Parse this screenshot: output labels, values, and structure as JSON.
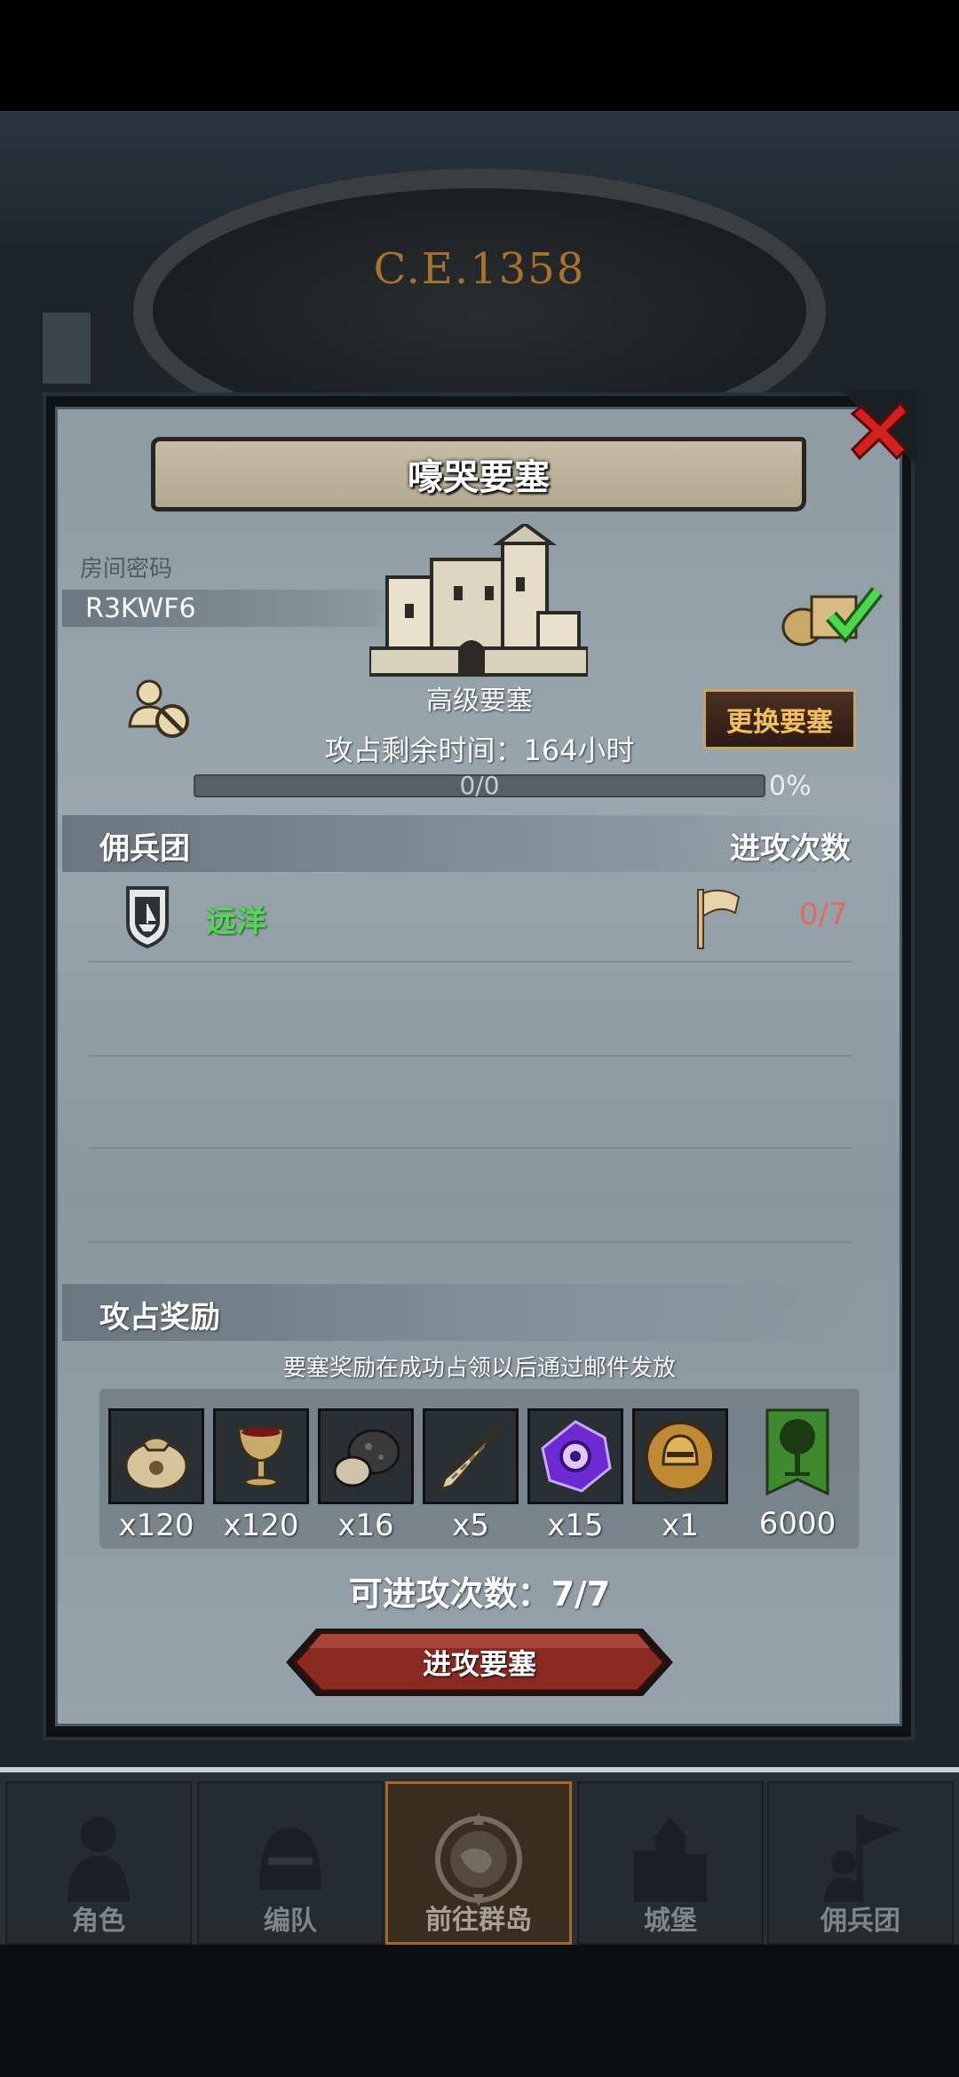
{
  "world": {
    "year_label": "C.E.1358"
  },
  "dialog": {
    "title": "嚎哭要塞",
    "room_password_label": "房间密码",
    "room_password": "R3KWF6",
    "fortress_type": "高级要塞",
    "change_fortress_button": "更换要塞",
    "remaining_time": "攻占剩余时间：164小时",
    "progress": {
      "text": "0/0",
      "percent_label": "0%",
      "fraction": 0
    },
    "mercenary_header": "佣兵团",
    "attack_count_header": "进攻次数",
    "mercenary_rows": [
      {
        "name": "远洋",
        "attacks": "0/7"
      }
    ],
    "rewards_header": "攻占奖励",
    "rewards_note": "要塞奖励在成功占领以后通过邮件发放",
    "rewards": [
      {
        "icon": "money-bag-icon",
        "qty": "x120"
      },
      {
        "icon": "goblet-icon",
        "qty": "x120"
      },
      {
        "icon": "ore-rock-icon",
        "qty": "x16"
      },
      {
        "icon": "horn-icon",
        "qty": "x5"
      },
      {
        "icon": "purple-gem-icon",
        "qty": "x15"
      },
      {
        "icon": "helmet-medal-icon",
        "qty": "x1"
      }
    ],
    "banner_reward": {
      "icon": "tree-banner-icon",
      "qty": "6000"
    },
    "attacks_left": "可进攻次数：7/7",
    "attack_button": "进攻要塞"
  },
  "bottom_nav": [
    {
      "label": "角色",
      "icon": "knight-icon",
      "active": false
    },
    {
      "label": "编队",
      "icon": "helmet-icon",
      "active": false
    },
    {
      "label": "前往群岛",
      "icon": "compass-map-icon",
      "active": true
    },
    {
      "label": "城堡",
      "icon": "castle-icon",
      "active": false
    },
    {
      "label": "佣兵团",
      "icon": "mercenary-banner-icon",
      "active": false
    }
  ],
  "colors": {
    "mercenary_name": "#4fdc4f",
    "attack_count": "#e06a5e",
    "change_button_text": "#f3c058",
    "close_icon": "#d42020"
  }
}
